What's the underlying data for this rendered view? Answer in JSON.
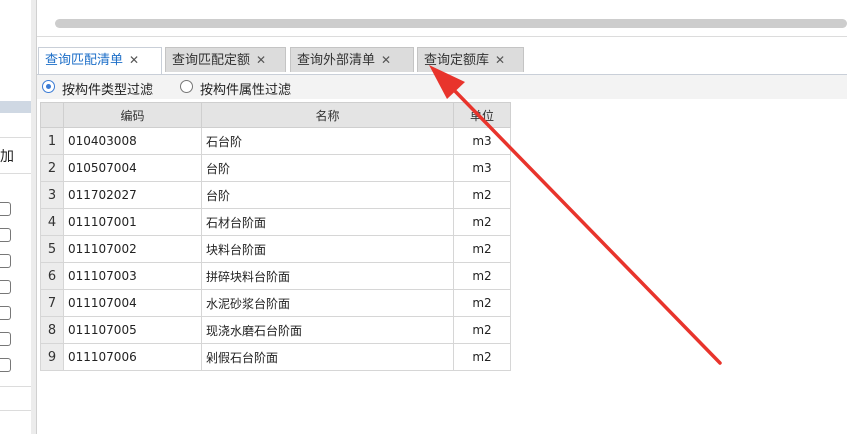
{
  "left_panel": {
    "partial_label": "加"
  },
  "tabs": [
    {
      "label": "查询匹配清单",
      "active": true
    },
    {
      "label": "查询匹配定额",
      "active": false
    },
    {
      "label": "查询外部清单",
      "active": false
    },
    {
      "label": "查询定额库",
      "active": false
    }
  ],
  "tab_close_glyph": "✕",
  "filters": [
    {
      "label": "按构件类型过滤",
      "selected": true
    },
    {
      "label": "按构件属性过滤",
      "selected": false
    }
  ],
  "table": {
    "headers": [
      "",
      "编码",
      "名称",
      "单位"
    ],
    "rows": [
      {
        "index": "1",
        "code": "010403008",
        "name": "石台阶",
        "unit": "m3"
      },
      {
        "index": "2",
        "code": "010507004",
        "name": "台阶",
        "unit": "m3"
      },
      {
        "index": "3",
        "code": "011702027",
        "name": "台阶",
        "unit": "m2"
      },
      {
        "index": "4",
        "code": "011107001",
        "name": "石材台阶面",
        "unit": "m2"
      },
      {
        "index": "5",
        "code": "011107002",
        "name": "块料台阶面",
        "unit": "m2"
      },
      {
        "index": "6",
        "code": "011107003",
        "name": "拼碎块料台阶面",
        "unit": "m2"
      },
      {
        "index": "7",
        "code": "011107004",
        "name": "水泥砂浆台阶面",
        "unit": "m2"
      },
      {
        "index": "8",
        "code": "011107005",
        "name": "现浇水磨石台阶面",
        "unit": "m2"
      },
      {
        "index": "9",
        "code": "011107006",
        "name": "剁假石台阶面",
        "unit": "m2"
      }
    ]
  },
  "colors": {
    "accent": "#1e6fc8",
    "annotation_arrow": "#e8342c"
  }
}
